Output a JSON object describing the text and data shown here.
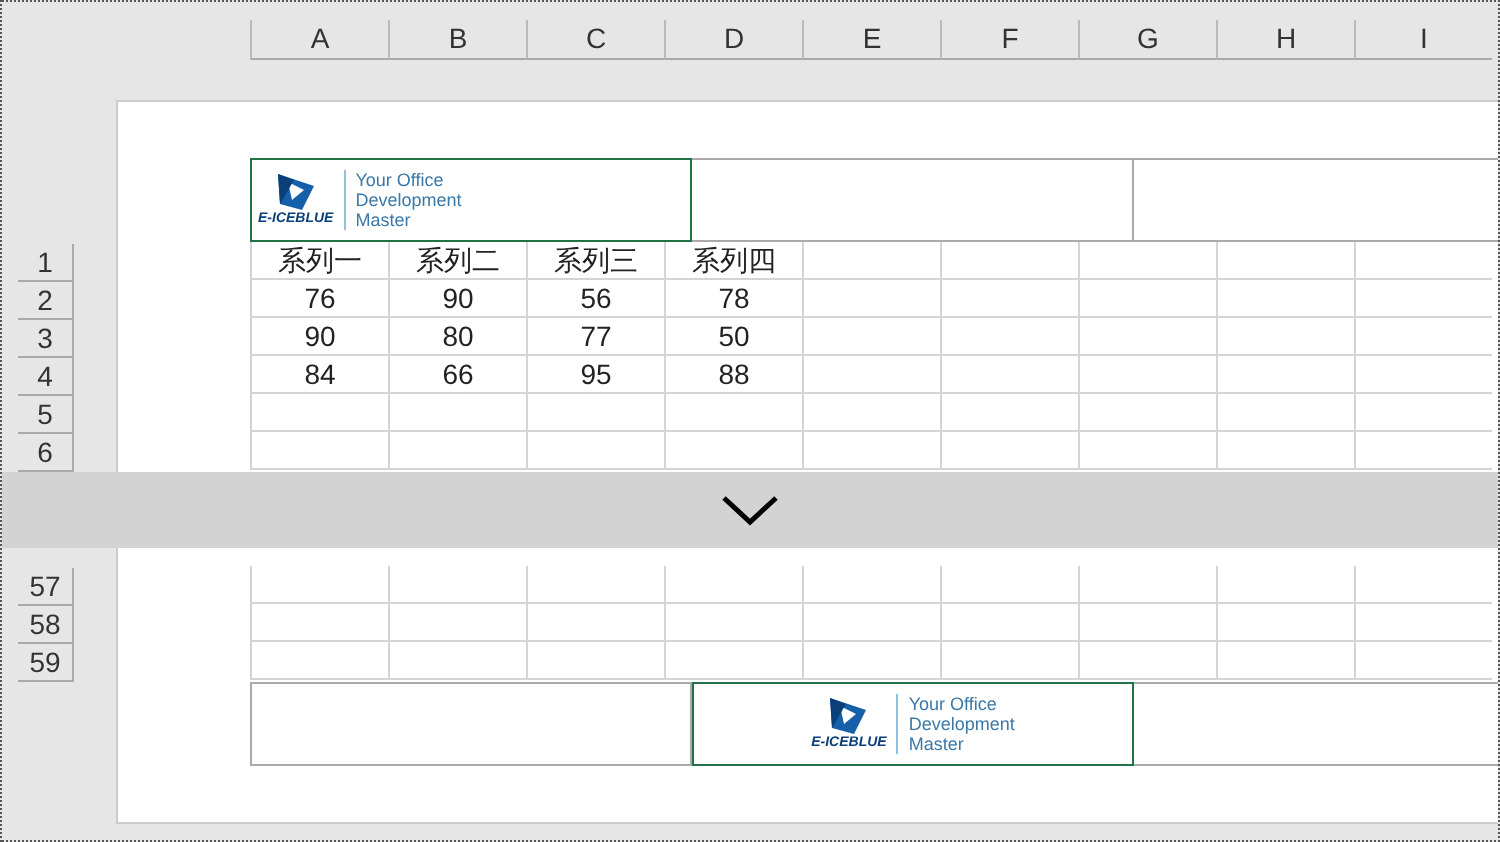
{
  "column_headers": [
    "A",
    "B",
    "C",
    "D",
    "E",
    "F",
    "G",
    "H",
    "I"
  ],
  "page_header": {
    "sections": [
      {
        "selected": true,
        "logo": {
          "brand": "E-ICEBLUE",
          "tagline": [
            "Your Office",
            "Development",
            "Master"
          ]
        }
      },
      {
        "selected": false
      },
      {
        "selected": false
      }
    ]
  },
  "rows_top": [
    {
      "number": "1",
      "cells": [
        "系列一",
        "系列二",
        "系列三",
        "系列四"
      ]
    },
    {
      "number": "2",
      "cells": [
        "76",
        "90",
        "56",
        "78"
      ]
    },
    {
      "number": "3",
      "cells": [
        "90",
        "80",
        "77",
        "50"
      ]
    },
    {
      "number": "4",
      "cells": [
        "84",
        "66",
        "95",
        "88"
      ]
    },
    {
      "number": "5"
    },
    {
      "number": "6"
    }
  ],
  "rows_bottom": [
    {
      "number": "57"
    },
    {
      "number": "58"
    },
    {
      "number": "59"
    }
  ],
  "page_footer": {
    "sections": [
      {
        "selected": false
      },
      {
        "selected": true,
        "logo": {
          "brand": "E-ICEBLUE",
          "tagline": [
            "Your Office",
            "Development",
            "Master"
          ]
        }
      },
      {
        "selected": false
      }
    ]
  }
}
